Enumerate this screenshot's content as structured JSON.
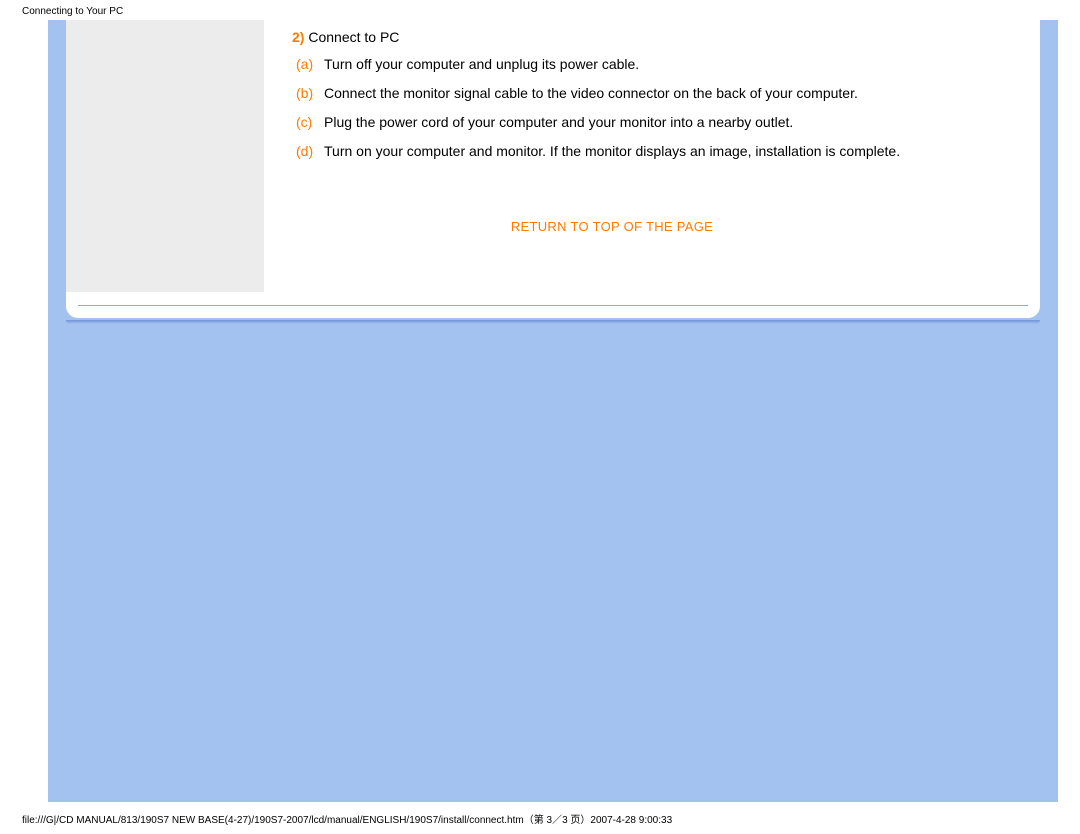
{
  "header": {
    "title": "Connecting to Your PC"
  },
  "section": {
    "number": "2)",
    "title": "Connect to PC",
    "steps": [
      {
        "letter": "(a)",
        "text": "Turn off your computer and unplug its power cable."
      },
      {
        "letter": "(b)",
        "text": "Connect the monitor signal cable to the video connector on the back of your computer."
      },
      {
        "letter": "(c)",
        "text": "Plug the power cord of your computer and your monitor into a nearby outlet."
      },
      {
        "letter": "(d)",
        "text": "Turn on your computer and monitor. If the monitor displays an image, installation is complete."
      }
    ]
  },
  "return_link": "RETURN TO TOP OF THE PAGE",
  "footer": {
    "path": "file:///G|/CD MANUAL/813/190S7 NEW BASE(4-27)/190S7-2007/lcd/manual/ENGLISH/190S7/install/connect.htm（第 3／3 页）2007-4-28 9:00:33"
  }
}
